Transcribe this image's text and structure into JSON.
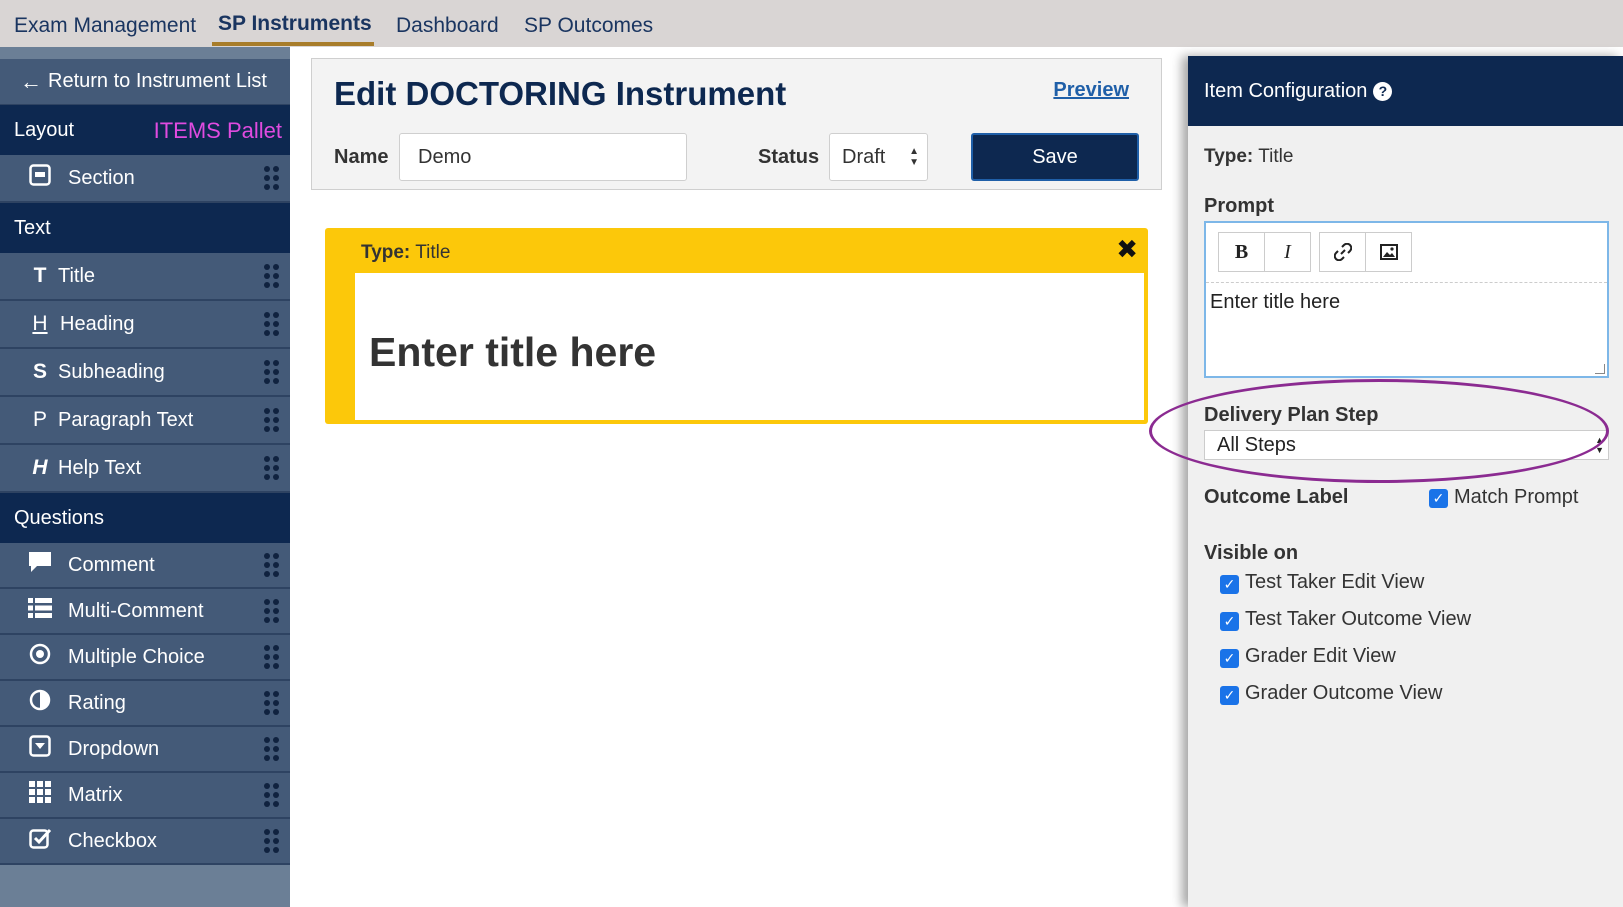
{
  "topnav": {
    "tabs": [
      {
        "label": "Exam Management"
      },
      {
        "label": "SP Instruments"
      },
      {
        "label": "Dashboard"
      },
      {
        "label": "SP Outcomes"
      }
    ]
  },
  "sidebar": {
    "return_label": "Return to Instrument List",
    "layout_header": "Layout",
    "pallet_label": "ITEMS Pallet",
    "layout_items": [
      {
        "label": "Section",
        "icon": "section-icon"
      }
    ],
    "text_header": "Text",
    "text_items": [
      {
        "label": "Title",
        "glyph": "T",
        "icon": "title-icon"
      },
      {
        "label": "Heading",
        "glyph": "H",
        "icon": "heading-icon"
      },
      {
        "label": "Subheading",
        "glyph": "S",
        "icon": "subheading-icon"
      },
      {
        "label": "Paragraph Text",
        "glyph": "P",
        "icon": "paragraph-icon"
      },
      {
        "label": "Help Text",
        "glyph": "H",
        "icon": "help-text-icon"
      }
    ],
    "questions_header": "Questions",
    "question_items": [
      {
        "label": "Comment",
        "icon": "comment-icon"
      },
      {
        "label": "Multi-Comment",
        "icon": "list-icon"
      },
      {
        "label": "Multiple Choice",
        "icon": "radio-icon"
      },
      {
        "label": "Rating",
        "icon": "half-circle-icon"
      },
      {
        "label": "Dropdown",
        "icon": "dropdown-icon"
      },
      {
        "label": "Matrix",
        "icon": "grid-icon"
      },
      {
        "label": "Checkbox",
        "icon": "checkbox-icon"
      }
    ]
  },
  "editor": {
    "title": "Edit DOCTORING Instrument",
    "preview_label": "Preview",
    "name_label": "Name",
    "name_value": "Demo",
    "status_label": "Status",
    "status_value": "Draft",
    "save_label": "Save"
  },
  "title_card": {
    "type_label": "Type:",
    "type_value": "Title",
    "title_text": "Enter title here"
  },
  "config": {
    "header": "Item Configuration",
    "type_label": "Type:",
    "type_value": "Title",
    "prompt_label": "Prompt",
    "prompt_text": "Enter title here",
    "toolbar": {
      "bold": "B",
      "italic": "I"
    },
    "delivery_label": "Delivery Plan Step",
    "delivery_value": "All Steps",
    "outcome_label": "Outcome Label",
    "match_prompt_label": "Match Prompt",
    "match_prompt_checked": true,
    "visible_label": "Visible on",
    "visible_options": [
      {
        "label": "Test Taker Edit View",
        "checked": true
      },
      {
        "label": "Test Taker Outcome View",
        "checked": true
      },
      {
        "label": "Grader Edit View",
        "checked": true
      },
      {
        "label": "Grader Outcome View",
        "checked": true
      }
    ]
  },
  "colors": {
    "navy": "#0d2850",
    "sidebar_item": "#445a78",
    "accent_yellow": "#fcc80a",
    "pallet_magenta": "#e04be0",
    "annotation_purple": "#8b2b91",
    "checkbox_blue": "#1a73e8",
    "tab_underline": "#a87d2a"
  }
}
